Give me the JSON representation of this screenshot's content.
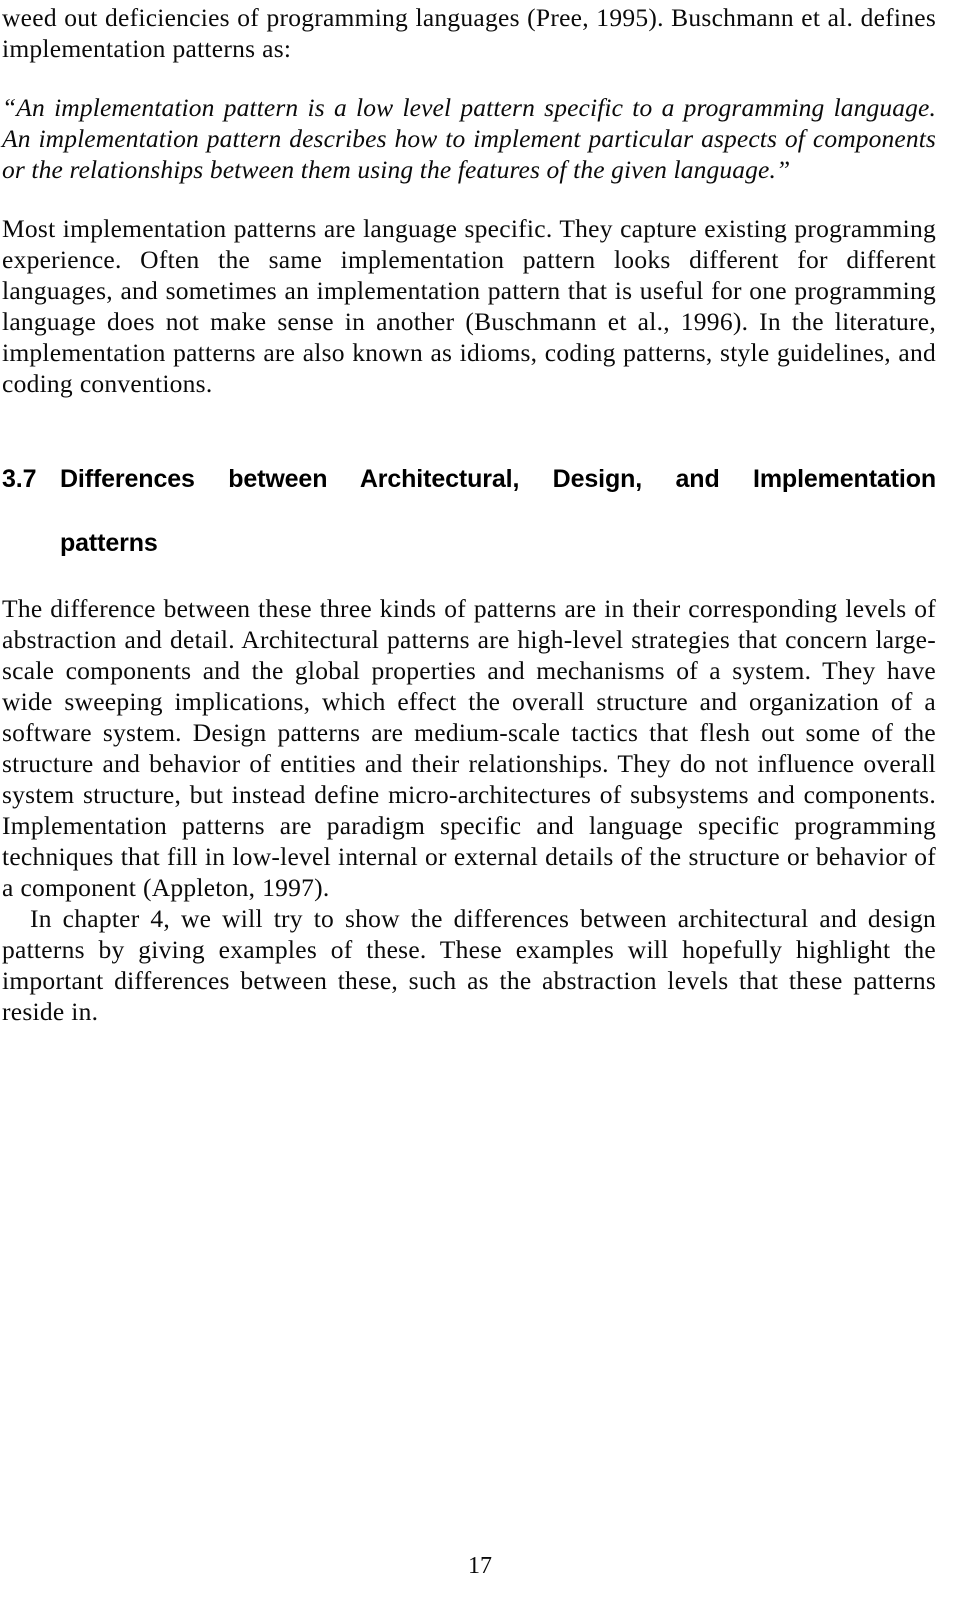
{
  "document": {
    "page_number": "17",
    "section": {
      "number": "3.7",
      "title": "Differences between Architectural, Design, and Implementation",
      "title_continuation": "patterns"
    },
    "paragraphs": {
      "intro": "weed out deficiencies of programming languages (Pree, 1995). Buschmann et al. defines implementation patterns as:",
      "blockquote": "“An implementation pattern is a low level pattern specific to a programming language. An implementation pattern describes how to implement particular aspects of components or the relationships between them using the features of the given language.”",
      "after_quote": "Most implementation patterns are language specific. They capture existing programming experience. Often the same implementation pattern looks different for different languages, and sometimes an implementation pattern that is useful for one programming language does not make sense in another (Buschmann et al., 1996). In the literature, implementation patterns are also known as idioms, coding patterns, style guidelines, and coding conventions.",
      "section_body": "The difference between these three kinds of patterns are in their corresponding levels of abstraction and detail. Architectural patterns are high-level strategies that concern large-scale components and the global properties and mechanisms of a system. They have wide sweeping implications, which effect the overall structure and organization of a software system. Design patterns are medium-scale tactics that flesh out some of the structure and behavior of entities and their relationships. They do not influence overall system structure, but instead define micro-architectures of subsystems and components. Implementation patterns are paradigm specific and language specific programming techniques that fill in low-level internal or external details of the structure or behavior of a component (Appleton, 1997).",
      "closing": "In chapter 4, we will try to show the differences between architectural and design patterns by giving examples of these. These examples will hopefully highlight the important differences between these, such as the abstraction levels that these patterns reside in."
    }
  }
}
